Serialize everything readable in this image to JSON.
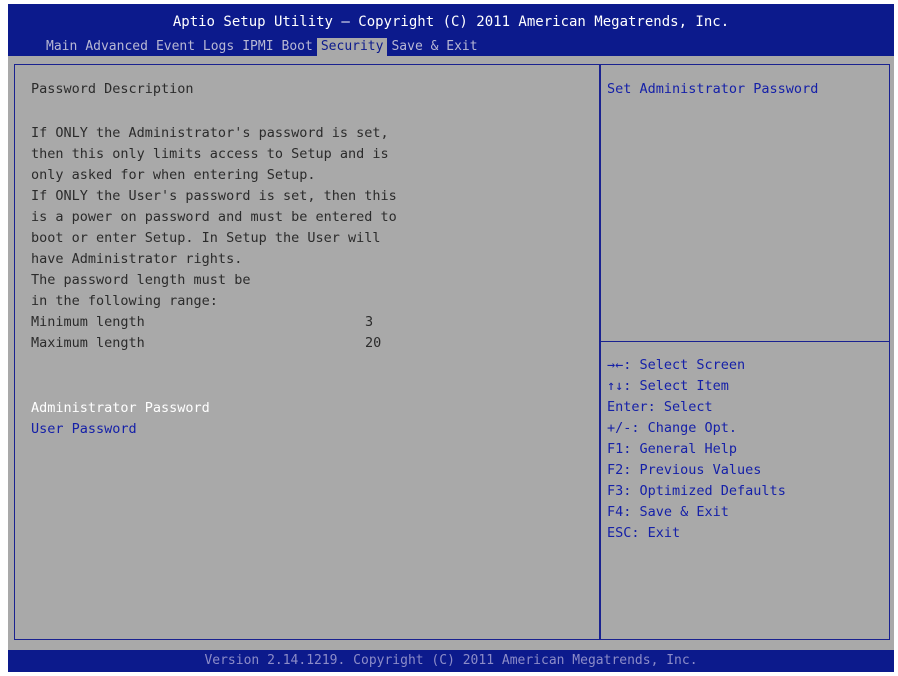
{
  "header": {
    "title": "Aptio Setup Utility – Copyright (C) 2011 American Megatrends, Inc.",
    "tabs": [
      {
        "label": "Main",
        "active": false
      },
      {
        "label": "Advanced",
        "active": false
      },
      {
        "label": "Event Logs",
        "active": false
      },
      {
        "label": "IPMI",
        "active": false
      },
      {
        "label": "Boot",
        "active": false
      },
      {
        "label": "Security",
        "active": true
      },
      {
        "label": "Save & Exit",
        "active": false
      }
    ]
  },
  "main": {
    "section_title": "Password Description",
    "description_lines": [
      "If ONLY the Administrator's password is set,",
      "then this only limits access to Setup and is",
      "only asked for when entering Setup.",
      "If ONLY the User's password is set, then this",
      "is a power on password and must be entered to",
      "boot or enter Setup. In Setup the User will",
      "have Administrator rights.",
      "The password length must be",
      "in the following range:"
    ],
    "min_label": "Minimum length",
    "min_value": "3",
    "max_label": "Maximum length",
    "max_value": "20",
    "admin_password_label": "Administrator Password",
    "user_password_label": "User Password"
  },
  "help": {
    "item_help": "Set Administrator Password",
    "keys": [
      {
        "key": "→←:",
        "desc": " Select Screen"
      },
      {
        "key": "↑↓:",
        "desc": " Select Item"
      },
      {
        "key": "Enter:",
        "desc": " Select"
      },
      {
        "key": "+/-:",
        "desc": " Change Opt."
      },
      {
        "key": "F1:",
        "desc": " General Help"
      },
      {
        "key": "F2:",
        "desc": " Previous Values"
      },
      {
        "key": "F3:",
        "desc": " Optimized Defaults"
      },
      {
        "key": "F4:",
        "desc": " Save & Exit"
      },
      {
        "key": "ESC:",
        "desc": " Exit"
      }
    ]
  },
  "footer": {
    "text": "Version 2.14.1219. Copyright (C) 2011 American Megatrends, Inc."
  },
  "colors": {
    "header_bg": "#0c1a8c",
    "screen_bg": "#a9a9a9",
    "selected_item": "#ffffff",
    "link_item": "#1520a8"
  }
}
